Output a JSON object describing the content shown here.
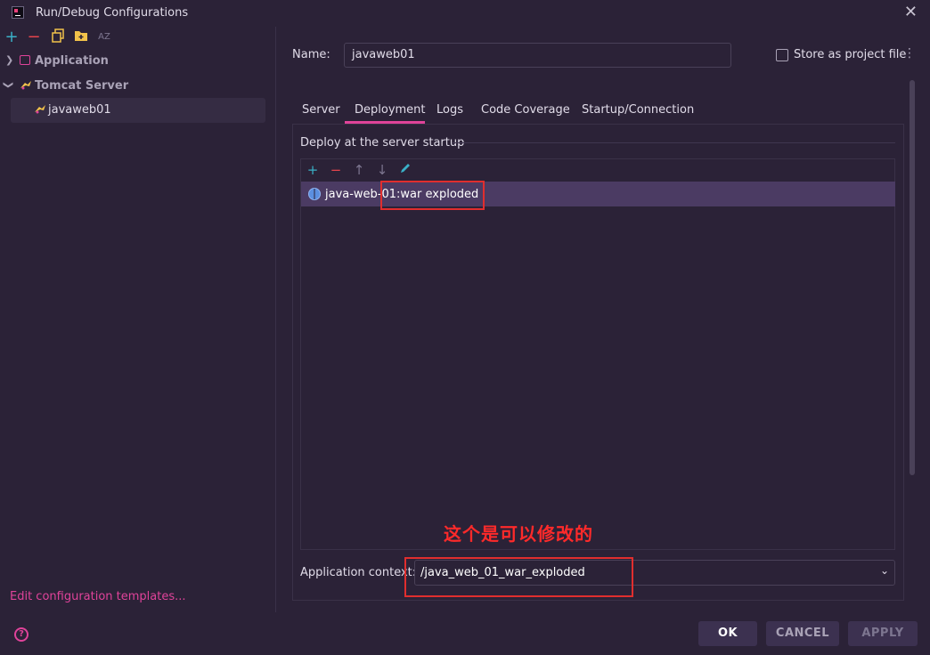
{
  "window": {
    "title": "Run/Debug Configurations",
    "close_glyph": "✕"
  },
  "left_toolbar": {
    "add_glyph": "+",
    "remove_glyph": "−",
    "sort_glyph": "AZ"
  },
  "tree": {
    "items": [
      {
        "label": "Application",
        "expanded": false
      },
      {
        "label": "Tomcat Server",
        "expanded": true,
        "children": [
          {
            "label": "javaweb01",
            "selected": true
          }
        ]
      }
    ]
  },
  "edit_templates_link": "Edit configuration templates...",
  "form": {
    "name_label": "Name:",
    "name_value": "javaweb01",
    "store_label": "Store as project file",
    "store_checked": false
  },
  "tabs": [
    {
      "label": "Server"
    },
    {
      "label": "Deployment",
      "active": true
    },
    {
      "label": "Logs"
    },
    {
      "label": "Code Coverage"
    },
    {
      "label": "Startup/Connection"
    }
  ],
  "deployment": {
    "group_title": "Deploy at the server startup",
    "items": [
      {
        "label": "java-web-01:war exploded",
        "selected": true
      }
    ],
    "annotation": "这个是可以修改的",
    "context_label": "Application context:",
    "context_value": "/java_web_01_war_exploded"
  },
  "buttons": {
    "ok": "OK",
    "cancel": "CANCEL",
    "apply": "APPLY"
  },
  "colors": {
    "accent": "#e0439a",
    "background": "#2b2237",
    "selection": "#4b3b63",
    "annotation_red": "#e02e2e"
  }
}
